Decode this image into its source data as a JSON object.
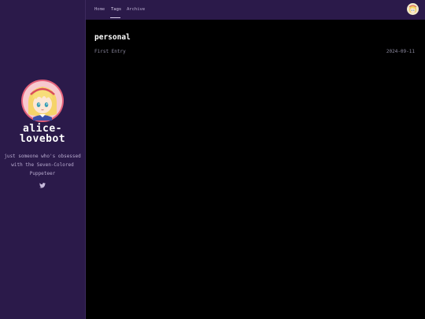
{
  "colors": {
    "sidebar_bg": "#2b1a4a",
    "main_bg": "#000000",
    "title_text": "#ffffff",
    "muted_text": "#b9acd0",
    "post_text": "#8d8aa0",
    "avatar_ring": "#e3607a"
  },
  "sidebar": {
    "avatar_icon": "anime-avatar-icon",
    "title": "alice-lovebot",
    "description": "just someone who's obsessed with the Seven-Colored Puppeteer",
    "social_icon": "twitter-icon"
  },
  "nav": {
    "items": [
      {
        "label": "Home"
      },
      {
        "label": "Tags"
      },
      {
        "label": "Archive"
      }
    ],
    "active": "Tags",
    "avatar_icon": "profile-avatar-icon"
  },
  "main": {
    "tag_name": "personal",
    "posts": [
      {
        "title": "First Entry",
        "date": "2024-09-11"
      }
    ]
  }
}
